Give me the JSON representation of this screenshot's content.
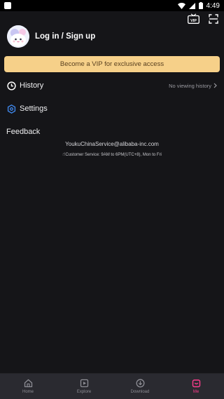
{
  "status_bar": {
    "time": "4:49"
  },
  "header": {
    "vip_badge": "VIP"
  },
  "profile": {
    "login_label": "Log in / Sign up"
  },
  "vip_banner": {
    "text": "Become a VIP for exclusive access"
  },
  "menu": {
    "history": {
      "label": "History",
      "right_text": "No viewing history"
    },
    "settings": {
      "label": "Settings"
    }
  },
  "feedback": {
    "title": "Feedback",
    "email": "YoukuChinaService@alibaba-inc.com",
    "service_hours": "Customer Service: 9AM to 6PM(UTC+8), Mon to Fri"
  },
  "tabs": [
    {
      "label": "Home",
      "icon": "home-icon",
      "active": false
    },
    {
      "label": "Explore",
      "icon": "explore-icon",
      "active": false
    },
    {
      "label": "Download",
      "icon": "download-icon",
      "active": false
    },
    {
      "label": "Me",
      "icon": "me-icon",
      "active": true
    }
  ],
  "colors": {
    "background": "#151518",
    "vip_banner": "#f6d089",
    "accent_active": "#ff3c8e",
    "tab_bar": "#2a2a30",
    "settings_icon": "#3f86e8"
  }
}
